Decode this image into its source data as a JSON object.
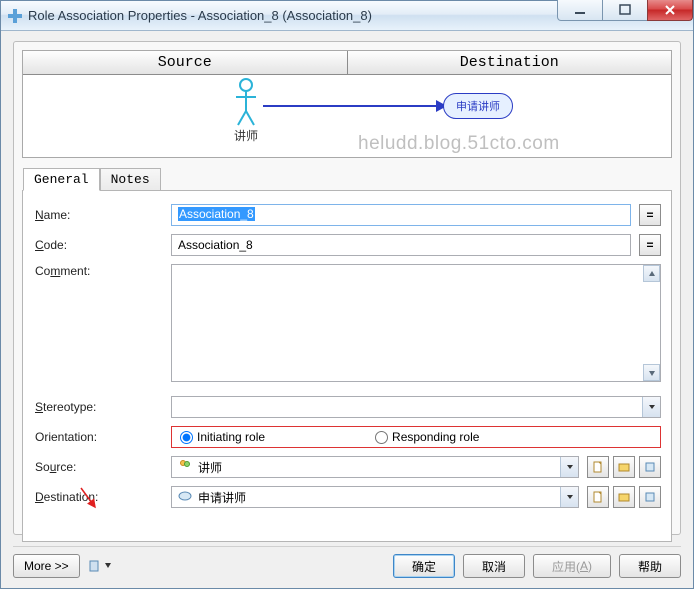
{
  "window": {
    "title": "Role Association Properties - Association_8 (Association_8)"
  },
  "sd": {
    "source_header": "Source",
    "destination_header": "Destination",
    "actor_label": "讲师",
    "usecase_label": "申请讲师",
    "watermark": "heludd.blog.51cto.com"
  },
  "tabs": {
    "general": "General",
    "notes": "Notes"
  },
  "form": {
    "name_label": "Name:",
    "name_value": "Association_8",
    "code_label": "Code:",
    "code_value": "Association_8",
    "comment_label": "Comment:",
    "stereotype_label": "Stereotype:",
    "stereotype_value": "",
    "orientation_label": "Orientation:",
    "orientation_initiating": "Initiating role",
    "orientation_responding": "Responding role",
    "source_label": "Source:",
    "source_value": "讲师",
    "destination_label": "Destination:",
    "destination_value": "申请讲师",
    "eq_button": "="
  },
  "buttons": {
    "more": "More >>",
    "ok": "确定",
    "cancel": "取消",
    "apply_plain": "应用(",
    "apply_key": "A",
    "apply_close": ")",
    "help": "帮助"
  }
}
